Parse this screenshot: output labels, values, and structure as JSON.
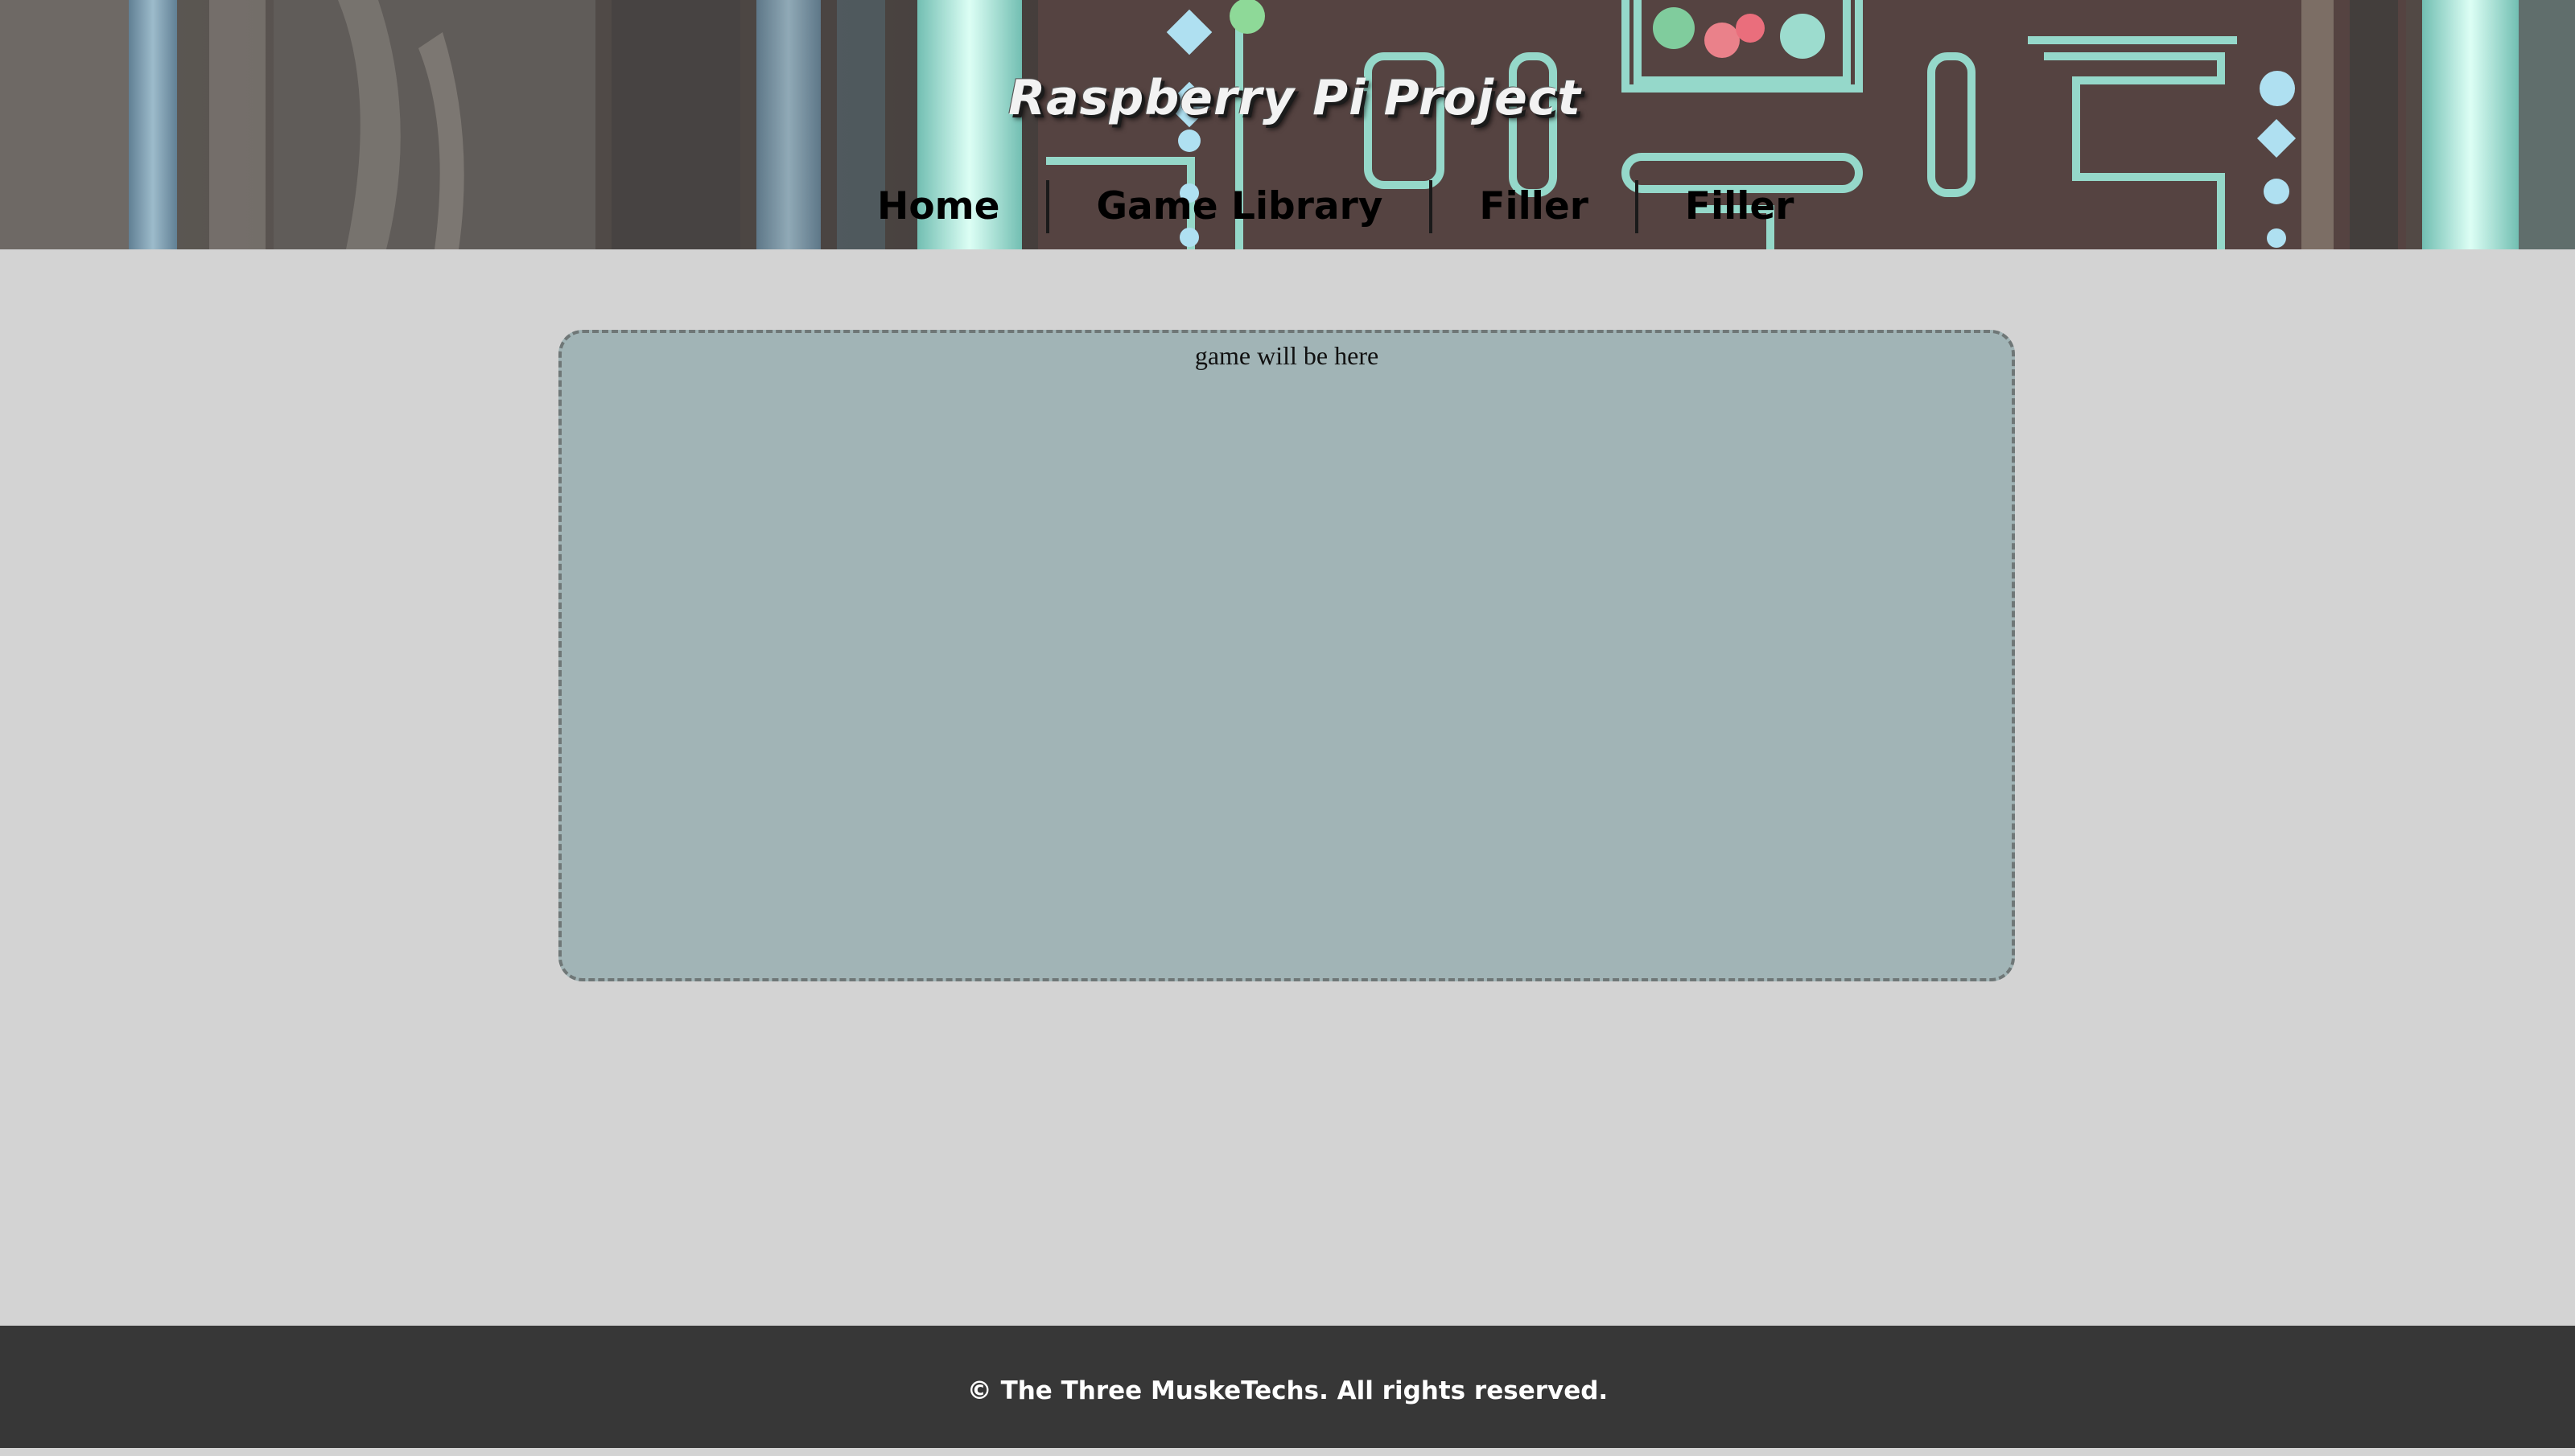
{
  "header": {
    "title": "Raspberry Pi Project",
    "background_image": "arcade-maze-photo"
  },
  "nav": {
    "items": [
      {
        "label": "Home"
      },
      {
        "label": "Game Library"
      },
      {
        "label": "Filler"
      },
      {
        "label": "Filler"
      }
    ]
  },
  "main": {
    "game_placeholder": "game will be here"
  },
  "footer": {
    "copyright": "© The Three MuskeTechs. All rights reserved."
  },
  "colors": {
    "page_background": "#d3d3d3",
    "game_box_background": "#a1b4b6",
    "game_box_border": "#6f7777",
    "footer_background": "#373737",
    "maze_lines": "#8fe6d4"
  }
}
